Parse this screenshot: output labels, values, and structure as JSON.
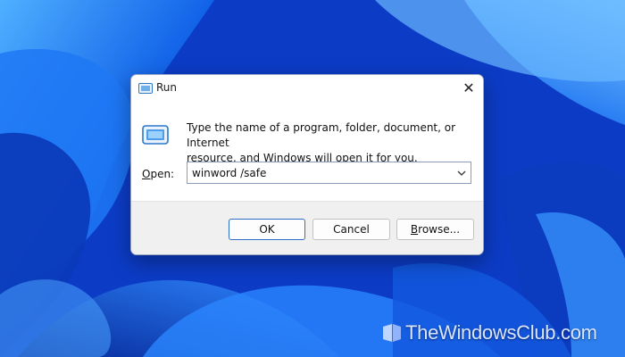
{
  "window": {
    "title": "Run",
    "close_glyph": "✕",
    "title_icon": "run-app-icon",
    "program_icon": "run-program-icon"
  },
  "description": {
    "line1": "Type the name of a program, folder, document, or Internet",
    "line2": "resource, and Windows will open it for you."
  },
  "open_field": {
    "label_accel": "O",
    "label_rest": "pen:",
    "value": "winword /safe"
  },
  "buttons": {
    "ok": "OK",
    "cancel": "Cancel",
    "browse_accel": "B",
    "browse_rest": "rowse..."
  },
  "watermark": {
    "text": "TheWindowsClub.com"
  },
  "colors": {
    "wallpaper_base": "#0b3fd0",
    "wallpaper_highlight": "#3fa0ff",
    "ok_border": "#2d6cc7",
    "footer_bg": "#f0f0f0"
  }
}
